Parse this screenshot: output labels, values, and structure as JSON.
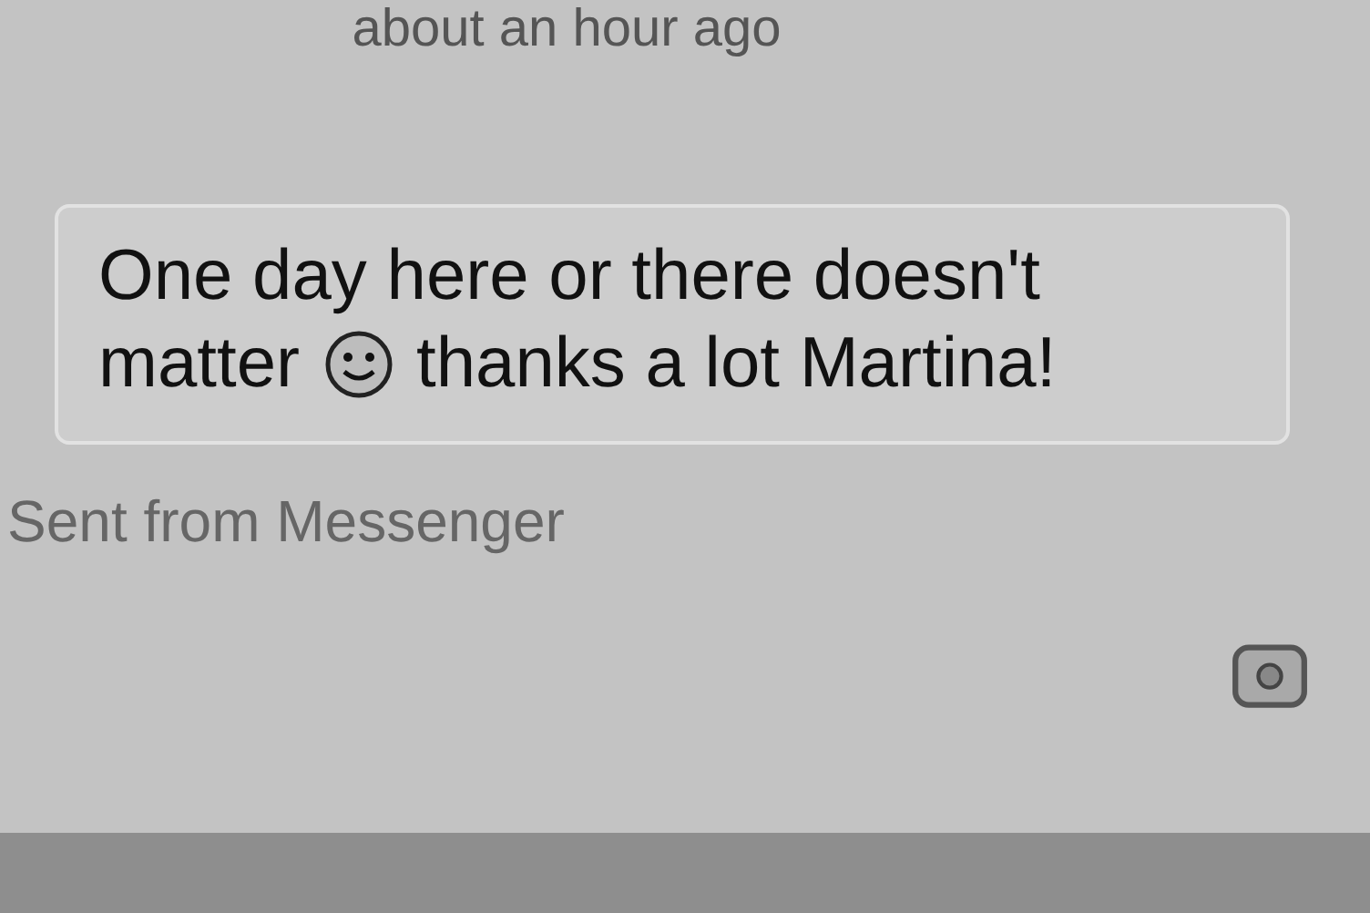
{
  "timestamp": "about an hour ago",
  "message": {
    "lines": [
      [
        {
          "kind": "text",
          "text": "One day here or there doesn't"
        }
      ],
      [
        {
          "kind": "text",
          "text": "matter"
        },
        {
          "kind": "smiley"
        },
        {
          "kind": "text",
          "text": "thanks a lot Martina!"
        }
      ]
    ]
  },
  "footer": "Sent from Messenger"
}
